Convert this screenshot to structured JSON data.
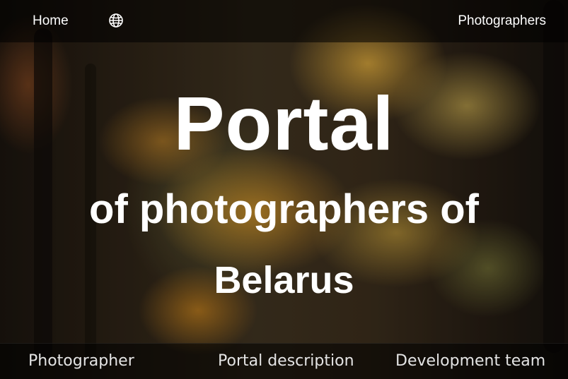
{
  "top_nav": {
    "home_label": "Home",
    "language_icon": "globe-icon",
    "photographers_label": "Photographers"
  },
  "hero": {
    "title": "Portal",
    "line2": "of photographers of",
    "line3": "Belarus"
  },
  "bottom_nav": {
    "items": [
      {
        "label": "Photographer"
      },
      {
        "label": "Portal description"
      },
      {
        "label": "Development team"
      }
    ]
  },
  "colors": {
    "text": "#ffffff",
    "nav_background": "rgba(0,0,0,0.55)",
    "foliage_accent": "#d9a23a"
  }
}
